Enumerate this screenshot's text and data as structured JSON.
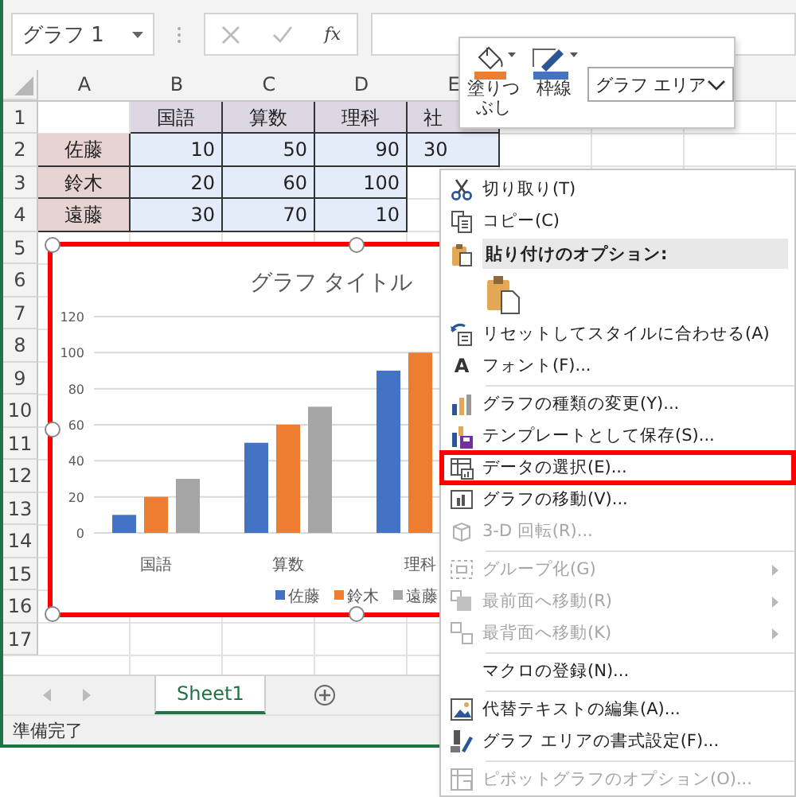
{
  "formula_bar": {
    "name_box": "グラフ 1",
    "function_label": "fx"
  },
  "mini_toolbar": {
    "fill_label": "塗りつぶし",
    "outline_label": "枠線",
    "element_dropdown": "グラフ エリア"
  },
  "grid": {
    "columns": [
      "A",
      "B",
      "C",
      "D",
      "E"
    ],
    "rows": [
      {
        "number": "1",
        "cells": [
          null,
          {
            "text": "国語",
            "kind": "label",
            "color": "#ddd7e3"
          },
          {
            "text": "算数",
            "kind": "label",
            "color": "#ddd7e3"
          },
          {
            "text": "理科",
            "kind": "label",
            "color": "#ddd7e3"
          },
          {
            "text": "社",
            "kind": "label",
            "color": "#ddd7e3"
          }
        ]
      },
      {
        "number": "2",
        "cells": [
          {
            "text": "佐藤",
            "kind": "label",
            "color": "#e8d3d3"
          },
          {
            "text": "10",
            "kind": "number",
            "color": "#e3ecf8"
          },
          {
            "text": "50",
            "kind": "number",
            "color": "#e3ecf8"
          },
          {
            "text": "90",
            "kind": "number",
            "color": "#e3ecf8"
          },
          {
            "text": "30",
            "kind": "number",
            "color": "#e3ecf8"
          }
        ]
      },
      {
        "number": "3",
        "cells": [
          {
            "text": "鈴木",
            "kind": "label",
            "color": "#e8d3d3"
          },
          {
            "text": "20",
            "kind": "number",
            "color": "#e3ecf8"
          },
          {
            "text": "60",
            "kind": "number",
            "color": "#e3ecf8"
          },
          {
            "text": "100",
            "kind": "number",
            "color": "#e3ecf8"
          }
        ]
      },
      {
        "number": "4",
        "cells": [
          {
            "text": "遠藤",
            "kind": "label",
            "color": "#e8d3d3"
          },
          {
            "text": "30",
            "kind": "number",
            "color": "#e3ecf8"
          },
          {
            "text": "70",
            "kind": "number",
            "color": "#e3ecf8"
          },
          {
            "text": "10",
            "kind": "number",
            "color": "#e3ecf8"
          }
        ]
      },
      {
        "number": "5"
      },
      {
        "number": "6"
      },
      {
        "number": "7"
      },
      {
        "number": "8"
      },
      {
        "number": "9"
      },
      {
        "number": "10"
      },
      {
        "number": "11"
      },
      {
        "number": "12"
      },
      {
        "number": "13"
      },
      {
        "number": "14"
      },
      {
        "number": "15"
      },
      {
        "number": "16"
      },
      {
        "number": "17"
      }
    ]
  },
  "chart": {
    "selected": true,
    "highlighted": true,
    "chart_data": {
      "type": "bar",
      "title": "グラフ タイトル",
      "categories": [
        "国語",
        "算数",
        "理科"
      ],
      "series": [
        {
          "name": "佐藤",
          "color": "#4472c4",
          "values": [
            10,
            50,
            90
          ]
        },
        {
          "name": "鈴木",
          "color": "#ed7d31",
          "values": [
            20,
            60,
            100
          ]
        },
        {
          "name": "遠藤",
          "color": "#a5a5a5",
          "values": [
            30,
            70,
            null
          ]
        }
      ],
      "ylim": [
        0,
        120
      ],
      "yticks": [
        {
          "value": 0,
          "label": "0"
        },
        {
          "value": 20,
          "label": "20"
        },
        {
          "value": 40,
          "label": "40"
        },
        {
          "value": 60,
          "label": "60"
        },
        {
          "value": 80,
          "label": "80"
        },
        {
          "value": 100,
          "label": "100"
        },
        {
          "value": 120,
          "label": "120"
        }
      ],
      "grid": true,
      "legend": true
    }
  },
  "context_menu": {
    "items": [
      {
        "kind": "command",
        "label": "切り取り(T)",
        "disabled": false,
        "submenu": false,
        "highlighted": false
      },
      {
        "kind": "command",
        "label": "コピー(C)",
        "disabled": false,
        "submenu": false,
        "highlighted": false
      },
      {
        "kind": "header",
        "label": "貼り付けのオプション:"
      },
      {
        "kind": "paste_buttons"
      },
      {
        "kind": "command",
        "label": "リセットしてスタイルに合わせる(A)",
        "disabled": false,
        "submenu": false,
        "highlighted": false
      },
      {
        "kind": "command",
        "label": "フォント(F)...",
        "icon_text": "A",
        "disabled": false,
        "submenu": false,
        "highlighted": false
      },
      {
        "kind": "separator"
      },
      {
        "kind": "command",
        "label": "グラフの種類の変更(Y)...",
        "disabled": false,
        "submenu": false,
        "highlighted": false
      },
      {
        "kind": "command",
        "label": "テンプレートとして保存(S)...",
        "disabled": false,
        "submenu": false,
        "highlighted": false
      },
      {
        "kind": "command",
        "label": "データの選択(E)...",
        "disabled": false,
        "submenu": false,
        "highlighted": true
      },
      {
        "kind": "command",
        "label": "グラフの移動(V)...",
        "disabled": false,
        "submenu": false,
        "highlighted": false
      },
      {
        "kind": "command",
        "label": "3-D 回転(R)...",
        "disabled": true,
        "submenu": false,
        "highlighted": false
      },
      {
        "kind": "separator"
      },
      {
        "kind": "command",
        "label": "グループ化(G)",
        "disabled": true,
        "submenu": true,
        "highlighted": false
      },
      {
        "kind": "command",
        "label": "最前面へ移動(R)",
        "disabled": true,
        "submenu": true,
        "highlighted": false
      },
      {
        "kind": "command",
        "label": "最背面へ移動(K)",
        "disabled": true,
        "submenu": true,
        "highlighted": false
      },
      {
        "kind": "separator"
      },
      {
        "kind": "command",
        "label": "マクロの登録(N)...",
        "disabled": false,
        "submenu": false,
        "highlighted": false
      },
      {
        "kind": "separator"
      },
      {
        "kind": "command",
        "label": "代替テキストの編集(A)...",
        "disabled": false,
        "submenu": false,
        "highlighted": false
      },
      {
        "kind": "command",
        "label": "グラフ エリアの書式設定(F)...",
        "disabled": false,
        "submenu": false,
        "highlighted": false
      },
      {
        "kind": "separator"
      },
      {
        "kind": "command",
        "label": "ピボットグラフのオプション(O)...",
        "disabled": true,
        "submenu": false,
        "highlighted": false
      }
    ]
  },
  "sheet_tabs": [
    {
      "label": "Sheet1",
      "selected": true
    }
  ],
  "status_bar": {
    "text": "準備完了"
  }
}
